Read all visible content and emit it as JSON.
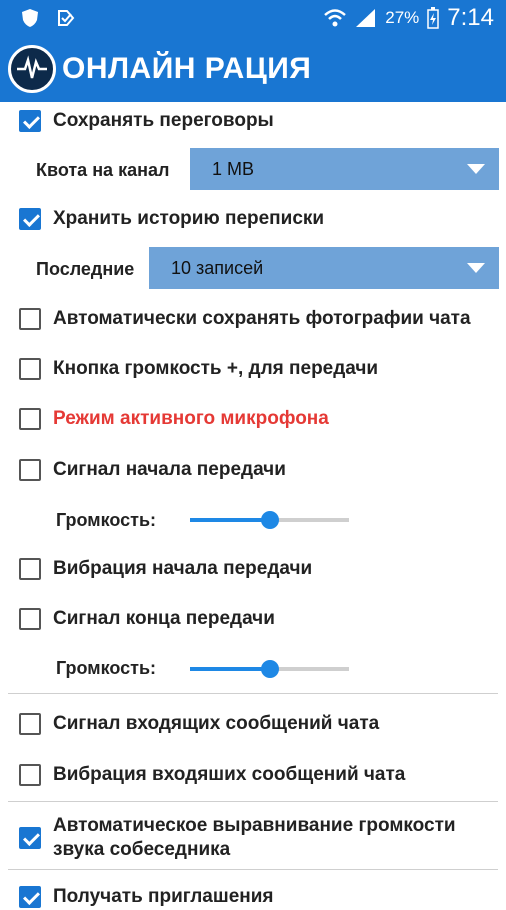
{
  "status_bar": {
    "battery": "27%",
    "time": "7:14"
  },
  "app": {
    "title": "ОНЛАЙН РАЦИЯ"
  },
  "settings": {
    "save_talks": {
      "label": "Сохранять переговоры",
      "checked": true
    },
    "quota": {
      "label": "Квота на канал",
      "value": "1 MB"
    },
    "keep_history": {
      "label": "Хранить историю переписки",
      "checked": true
    },
    "last": {
      "label": "Последние",
      "value": "10 записей"
    },
    "auto_save_photos": {
      "label": "Автоматически сохранять фотографии чата",
      "checked": false
    },
    "volume_button": {
      "label": "Кнопка громкость +, для передачи",
      "checked": false
    },
    "active_mic": {
      "label": "Режим активного микрофона",
      "checked": false,
      "color": "#e53935"
    },
    "tx_start_signal": {
      "label": "Сигнал начала передачи",
      "checked": false
    },
    "tx_start_volume": {
      "label": "Громкость:",
      "level": 0.5
    },
    "tx_start_vibration": {
      "label": "Вибрация начала передачи",
      "checked": false
    },
    "tx_end_signal": {
      "label": "Сигнал конца передачи",
      "checked": false
    },
    "tx_end_volume": {
      "label": "Громкость:",
      "level": 0.5
    },
    "chat_incoming_signal": {
      "label": "Сигнал входящих сообщений чата",
      "checked": false
    },
    "chat_incoming_vibration": {
      "label": "Вибрация входяших сообщений чата",
      "checked": false
    },
    "auto_volume": {
      "label": "Автоматическое выравнивание громкости звука собеседника",
      "checked": true
    },
    "invitations": {
      "label": "Получать приглашения",
      "checked": true
    }
  },
  "colors": {
    "accent": "#1976d2",
    "dropdown": "#6fa3d8",
    "slider": "#1e88e5"
  }
}
